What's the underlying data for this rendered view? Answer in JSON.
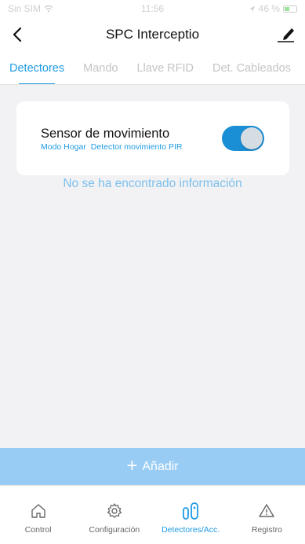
{
  "status_bar": {
    "carrier": "Sin SIM",
    "time": "11:56",
    "battery": "46 %"
  },
  "header": {
    "title": "SPC Interceptio",
    "back_icon": "chevron-left-icon",
    "edit_icon": "edit-pencil-icon"
  },
  "tabs": [
    {
      "label": "Detectores",
      "active": true
    },
    {
      "label": "Mando",
      "active": false
    },
    {
      "label": "Llave RFID",
      "active": false
    },
    {
      "label": "Det. Cableados",
      "active": false
    }
  ],
  "device": {
    "name": "Sensor de movimiento",
    "mode": "Modo Hogar",
    "type": "Detector movimiento PIR",
    "enabled": true
  },
  "empty_message": "No se ha encontrado información",
  "add_button": {
    "label": "Añadir",
    "icon": "plus-icon"
  },
  "bottom_nav": [
    {
      "label": "Control",
      "icon": "home-icon",
      "active": false
    },
    {
      "label": "Configuración",
      "icon": "gear-icon",
      "active": false
    },
    {
      "label": "Detectores/Acc.",
      "icon": "sensor-icon",
      "active": true
    },
    {
      "label": "Registro",
      "icon": "warning-icon",
      "active": false
    }
  ],
  "colors": {
    "accent": "#1e9be3",
    "add_button_bg": "#98ccf4",
    "toggle_on": "#1a8fd6",
    "background": "#f2f2f4"
  }
}
